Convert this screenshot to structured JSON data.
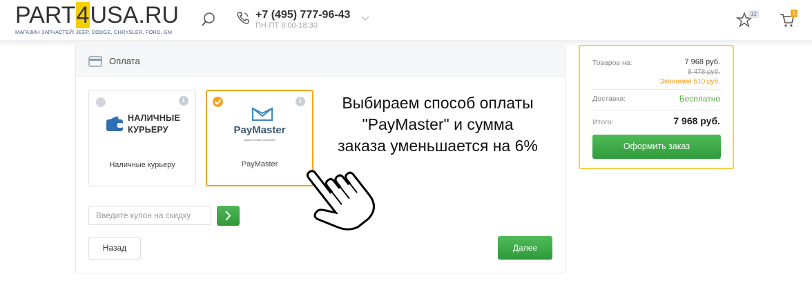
{
  "header": {
    "logo_pre": "PART",
    "logo_four": "4",
    "logo_post": "USA.RU",
    "tagline": "МАГАЗИН ЗАПЧАСТЕЙ: JEEP, DODGE, CHRYSLER, FORD, GM",
    "phone": "+7 (495) 777-96-43",
    "hours": "ПН-ПТ 9:00-18:30",
    "favorites_count": "12",
    "cart_count": "5",
    "icons": [
      "search-icon",
      "phone-icon",
      "chevron-down-icon",
      "star-icon",
      "cart-icon"
    ]
  },
  "payment": {
    "title": "Оплата",
    "options": [
      {
        "logo_text_line1": "НАЛИЧНЫЕ",
        "logo_text_line2": "КУРЬЕРУ",
        "caption": "Наличные курьеру",
        "selected": false
      },
      {
        "logo_text": "PayMaster",
        "logo_sub": "прием онлайн-платежей",
        "caption": "PayMaster",
        "selected": true
      }
    ],
    "coupon_placeholder": "Введите купон на скидку",
    "back_label": "Назад",
    "next_label": "Далее"
  },
  "annotation": {
    "text_line1": "Выбираем способ оплаты",
    "text_line2": "\"PayMaster\" и сумма",
    "text_line3": "заказа уменьшается на 6%"
  },
  "summary": {
    "goods_label": "Товаров на:",
    "goods_value": "7 968 руб.",
    "old_value": "8 478 руб.",
    "economy": "Экономия 510 руб.",
    "delivery_label": "Доставка:",
    "delivery_value": "Бесплатно",
    "total_label": "Итого:",
    "total_value": "7 968 руб.",
    "order_button": "Оформить заказ"
  },
  "colors": {
    "accent_orange": "#f4a51c",
    "green_button": "#3aa844",
    "summary_border": "#f4d24a",
    "logo_yellow": "#f4d000"
  }
}
